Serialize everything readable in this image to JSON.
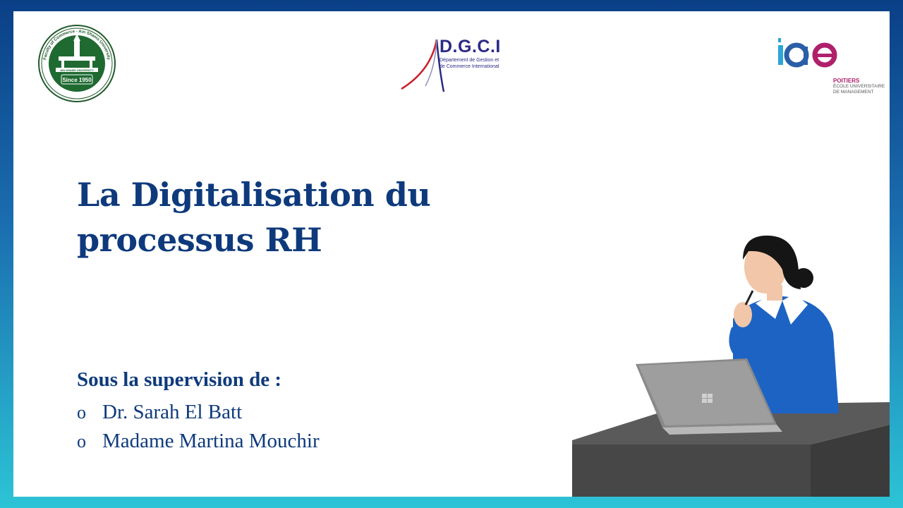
{
  "title": {
    "line1": "La Digitalisation du",
    "line2": "processus RH"
  },
  "supervision": {
    "heading": "Sous la supervision de :",
    "bullet": "o",
    "items": [
      "Dr. Sarah El Batt",
      "Madame Martina Mouchir"
    ]
  },
  "logos": {
    "ain_shams": {
      "top_text": "Faculty of Commerce - Ain Shams University",
      "since": "Since 1950",
      "band": "AIN SHAMS UNIVERSITY"
    },
    "dgci": {
      "name": "D.G.C.I",
      "subtitle": "Département de Gestion et de Commerce International"
    },
    "iae": {
      "mark": "iae",
      "city": "POITIERS",
      "school": "ÉCOLE UNIVERSITAIRE DE MANAGEMENT"
    }
  },
  "colors": {
    "title": "#0e3a7c",
    "frame_top": "#0a3f86",
    "frame_bottom": "#2cc4d6"
  },
  "icons": [
    "laptop-icon",
    "person-illustration"
  ]
}
